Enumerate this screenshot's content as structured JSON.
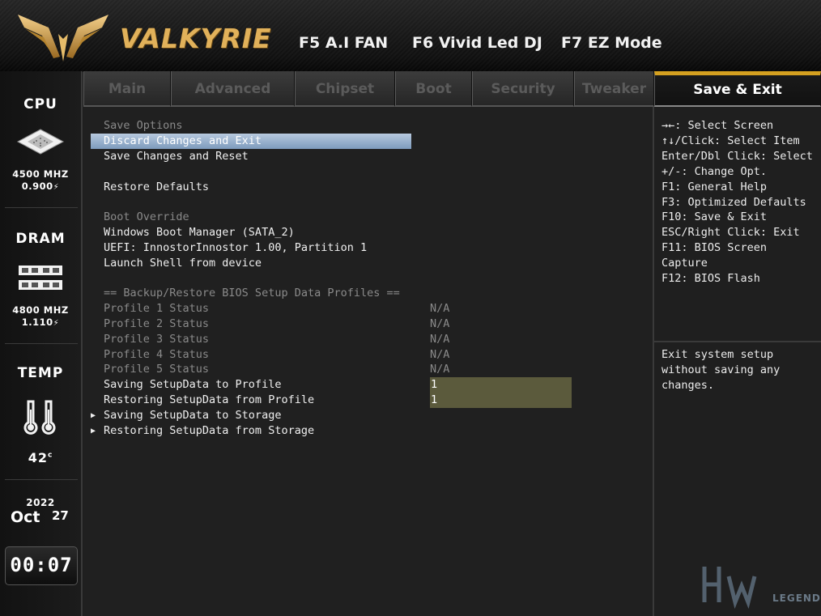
{
  "header": {
    "brand": "VALKYRIE",
    "fkeys": [
      "F5 A.I FAN",
      "F6 Vivid Led DJ",
      "F7 EZ Mode"
    ]
  },
  "sidebar": {
    "cpu_title": "CPU",
    "cpu_freq": "4500 MHZ",
    "cpu_volt": "0.900",
    "dram_title": "DRAM",
    "dram_freq": "4800 MHZ",
    "dram_volt": "1.110",
    "temp_title": "TEMP",
    "temp_value": "42",
    "temp_unit": "c",
    "year": "2022",
    "month": "Oct",
    "day": "27",
    "time": "00:07"
  },
  "tabs": [
    {
      "label": "Main"
    },
    {
      "label": "Advanced"
    },
    {
      "label": "Chipset"
    },
    {
      "label": "Boot"
    },
    {
      "label": "Security"
    },
    {
      "label": "Tweaker"
    },
    {
      "label": "Save & Exit"
    }
  ],
  "main": {
    "save_options_header": "Save Options",
    "discard_exit": "Discard Changes and Exit",
    "save_reset": "Save Changes and Reset",
    "restore_defaults": "Restore Defaults",
    "boot_override_header": "Boot Override",
    "boot_windows": "Windows Boot Manager (SATA_2)",
    "boot_uefi": "UEFI: InnostorInnostor 1.00, Partition 1",
    "launch_shell": "Launch Shell from device",
    "profiles_header": "== Backup/Restore BIOS Setup Data Profiles ==",
    "profiles": [
      {
        "label": "Profile 1 Status",
        "value": "N/A"
      },
      {
        "label": "Profile 2 Status",
        "value": "N/A"
      },
      {
        "label": "Profile 3 Status",
        "value": "N/A"
      },
      {
        "label": "Profile 4 Status",
        "value": "N/A"
      },
      {
        "label": "Profile 5 Status",
        "value": "N/A"
      }
    ],
    "saving_profile": {
      "label": "Saving SetupData to Profile",
      "value": "1"
    },
    "restoring_profile": {
      "label": "Restoring SetupData from Profile",
      "value": "1"
    },
    "saving_storage": "Saving SetupData to Storage",
    "restoring_storage": "Restoring SetupData from Storage"
  },
  "help": {
    "keys": [
      "→←: Select Screen",
      "↑↓/Click: Select Item",
      "Enter/Dbl Click: Select",
      "+/-: Change Opt.",
      "F1: General Help",
      "F3: Optimized Defaults",
      "F10: Save & Exit",
      "ESC/Right Click: Exit",
      "F11: BIOS Screen",
      "Capture",
      "F12: BIOS Flash"
    ],
    "description": [
      "Exit system setup",
      "without saving any",
      "changes."
    ]
  },
  "watermark": "LEGEND",
  "colors": {
    "accent_gold": "#d4a020",
    "brand_gold": "#e1b15a",
    "selection": "#9ab3cf",
    "value_box": "#5b5a3c"
  }
}
